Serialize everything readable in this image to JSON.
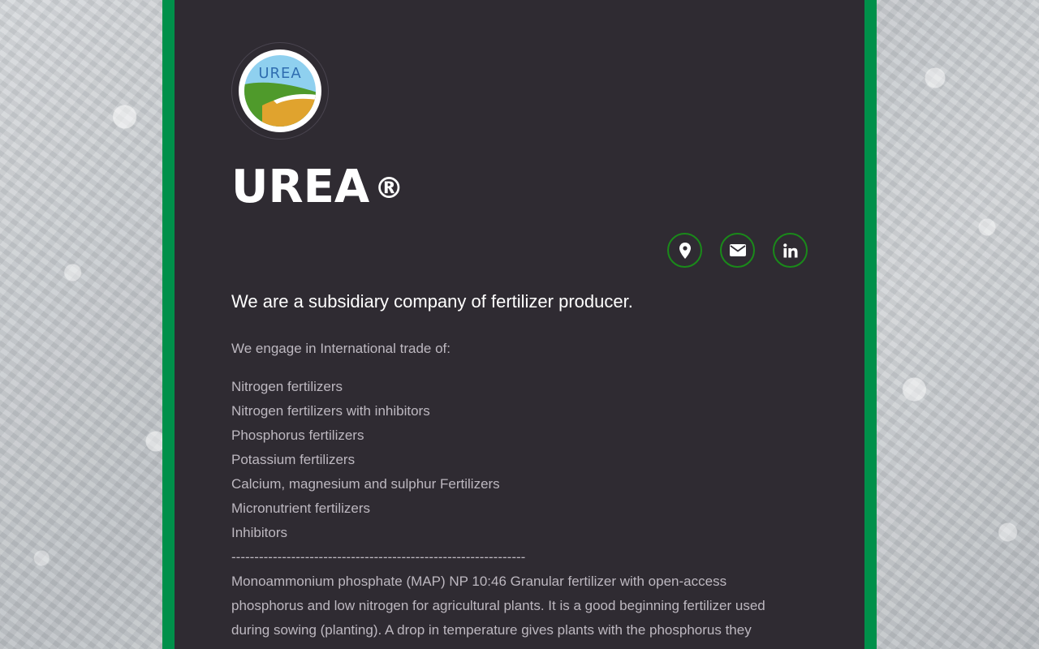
{
  "brand": {
    "logo_text": "UREA",
    "title": "UREA",
    "trademark": "®"
  },
  "socials": [
    {
      "icon": "map-marker-icon"
    },
    {
      "icon": "envelope-icon"
    },
    {
      "icon": "linkedin-icon"
    }
  ],
  "lead": "We are a subsidiary company of fertilizer producer.",
  "intro": "We engage in International trade of:",
  "products": [
    "Nitrogen fertilizers",
    "Nitrogen fertilizers with inhibitors",
    "Phosphorus fertilizers",
    "Potassium fertilizers",
    "Calcium, magnesium and sulphur Fertilizers",
    "Micronutrient fertilizers",
    "Inhibitors"
  ],
  "separator": "----------------------------------------------------------------",
  "description": "Monoammonium phosphate (MAP) NP 10:46 Granular fertilizer with open-access phosphorus and low nitrogen for agricultural plants. It is a good beginning fertilizer used during sowing (planting). A drop in temperature gives plants with the phosphorus they",
  "colors": {
    "accent_green": "#00904a",
    "panel": "#2f2b32",
    "icon_ring": "#1a8a1a"
  }
}
